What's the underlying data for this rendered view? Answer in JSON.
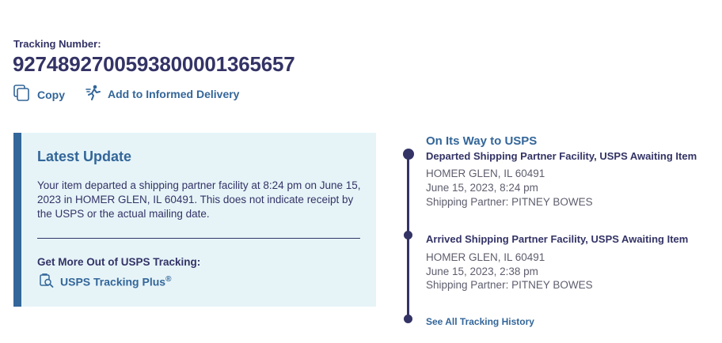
{
  "tracking": {
    "label": "Tracking Number:",
    "number": "9274892700593800001365657",
    "copy_label": "Copy",
    "informed_delivery_label": "Add to Informed Delivery"
  },
  "latest_update": {
    "title": "Latest Update",
    "text": "Your item departed a shipping partner facility at 8:24 pm on June 15, 2023 in HOMER GLEN, IL 60491. This does not indicate receipt by the USPS or the actual mailing date.",
    "more_title": "Get More Out of USPS Tracking:",
    "plus_label": "USPS Tracking Plus",
    "plus_sup": "®"
  },
  "timeline": {
    "status": "On Its Way to USPS",
    "events": [
      {
        "title": "Departed Shipping Partner Facility, USPS Awaiting Item",
        "location": "HOMER GLEN, IL 60491",
        "datetime": "June 15, 2023, 8:24 pm",
        "partner": "Shipping Partner: PITNEY BOWES"
      },
      {
        "title": "Arrived Shipping Partner Facility, USPS Awaiting Item",
        "location": "HOMER GLEN, IL 60491",
        "datetime": "June 15, 2023, 2:38 pm",
        "partner": "Shipping Partner: PITNEY BOWES"
      }
    ],
    "history_link": "See All Tracking History"
  },
  "colors": {
    "navy": "#333366",
    "link_blue": "#336699",
    "card_bg": "#e6f4f8",
    "muted_text": "#5e5e6e"
  },
  "icons": [
    "copy-icon",
    "informed-delivery-icon",
    "tracking-plus-icon"
  ]
}
